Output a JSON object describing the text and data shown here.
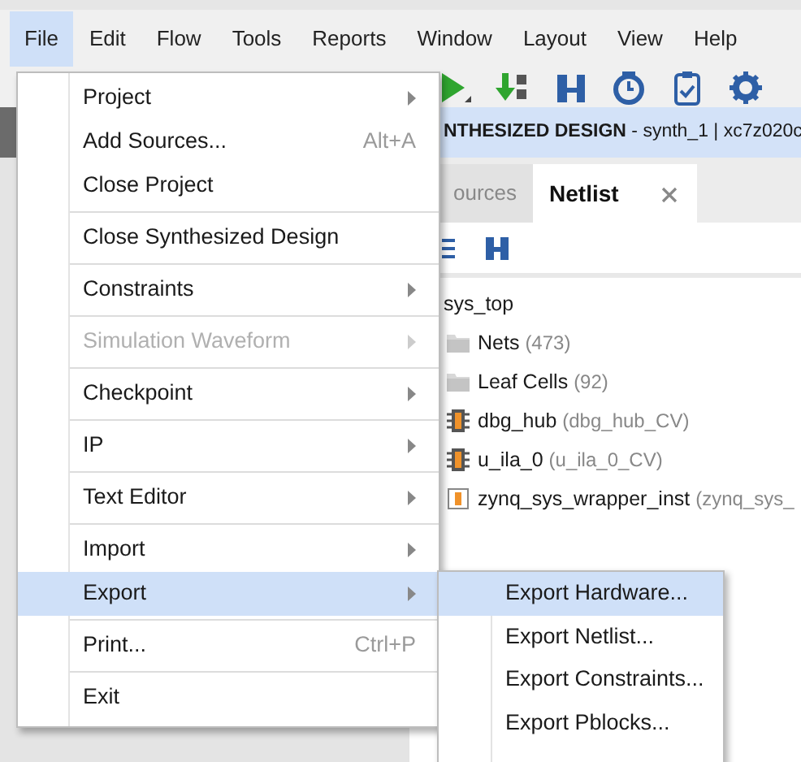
{
  "menubar": [
    {
      "label": "File",
      "selected": true
    },
    {
      "label": "Edit",
      "selected": false
    },
    {
      "label": "Flow",
      "selected": false
    },
    {
      "label": "Tools",
      "selected": false
    },
    {
      "label": "Reports",
      "selected": false
    },
    {
      "label": "Window",
      "selected": false
    },
    {
      "label": "Layout",
      "selected": false
    },
    {
      "label": "View",
      "selected": false
    },
    {
      "label": "Help",
      "selected": false
    }
  ],
  "banner": {
    "title": "**NTHESIZED DESIGN** - synth_1 | xc7z020c"
  },
  "tabs": [
    {
      "label": "ources",
      "selected": false
    },
    {
      "label": "Netlist",
      "selected": true
    }
  ],
  "tree": {
    "label": "sys_top",
    "children": [
      {
        "kind": "folder",
        "label": "Nets",
        "detail": "(473)"
      },
      {
        "kind": "folder",
        "label": "Leaf Cells",
        "detail": "(92)"
      },
      {
        "kind": "cell",
        "label": "dbg_hub",
        "detail": "(dbg_hub_CV)"
      },
      {
        "kind": "cell",
        "label": "u_ila_0",
        "detail": "(u_ila_0_CV)"
      },
      {
        "kind": "module",
        "label": "zynq_sys_wrapper_inst",
        "detail": "(zynq_sys_"
      }
    ]
  },
  "file_menu": {
    "groups": [
      [
        {
          "label": "Project",
          "submenu": true,
          "disabled": false,
          "selected": false
        },
        {
          "label": "Add Sources...",
          "shortcut": "Alt+A",
          "submenu": false,
          "disabled": false,
          "selected": false
        },
        {
          "label": "Close Project",
          "submenu": false,
          "disabled": false,
          "selected": false
        }
      ],
      [
        {
          "label": "Close Synthesized Design",
          "submenu": false,
          "disabled": false,
          "selected": false
        }
      ],
      [
        {
          "label": "Constraints",
          "submenu": true,
          "disabled": false,
          "selected": false
        }
      ],
      [
        {
          "label": "Simulation Waveform",
          "submenu": true,
          "disabled": true,
          "selected": false
        }
      ],
      [
        {
          "label": "Checkpoint",
          "submenu": true,
          "disabled": false,
          "selected": false
        }
      ],
      [
        {
          "label": "IP",
          "submenu": true,
          "disabled": false,
          "selected": false
        }
      ],
      [
        {
          "label": "Text Editor",
          "submenu": true,
          "disabled": false,
          "selected": false
        }
      ],
      [
        {
          "label": "Import",
          "submenu": true,
          "disabled": false,
          "selected": false
        },
        {
          "label": "Export",
          "submenu": true,
          "disabled": false,
          "selected": true
        }
      ],
      [
        {
          "label": "Print...",
          "shortcut": "Ctrl+P",
          "submenu": false,
          "disabled": false,
          "selected": false
        }
      ],
      [
        {
          "label": "Exit",
          "submenu": false,
          "disabled": false,
          "selected": false
        }
      ]
    ]
  },
  "export_menu": [
    {
      "label": "Export Hardware...",
      "selected": true
    },
    {
      "label": "Export Netlist...",
      "selected": false
    },
    {
      "label": "Export Constraints...",
      "selected": false
    },
    {
      "label": "Export Pblocks...",
      "selected": false
    }
  ]
}
